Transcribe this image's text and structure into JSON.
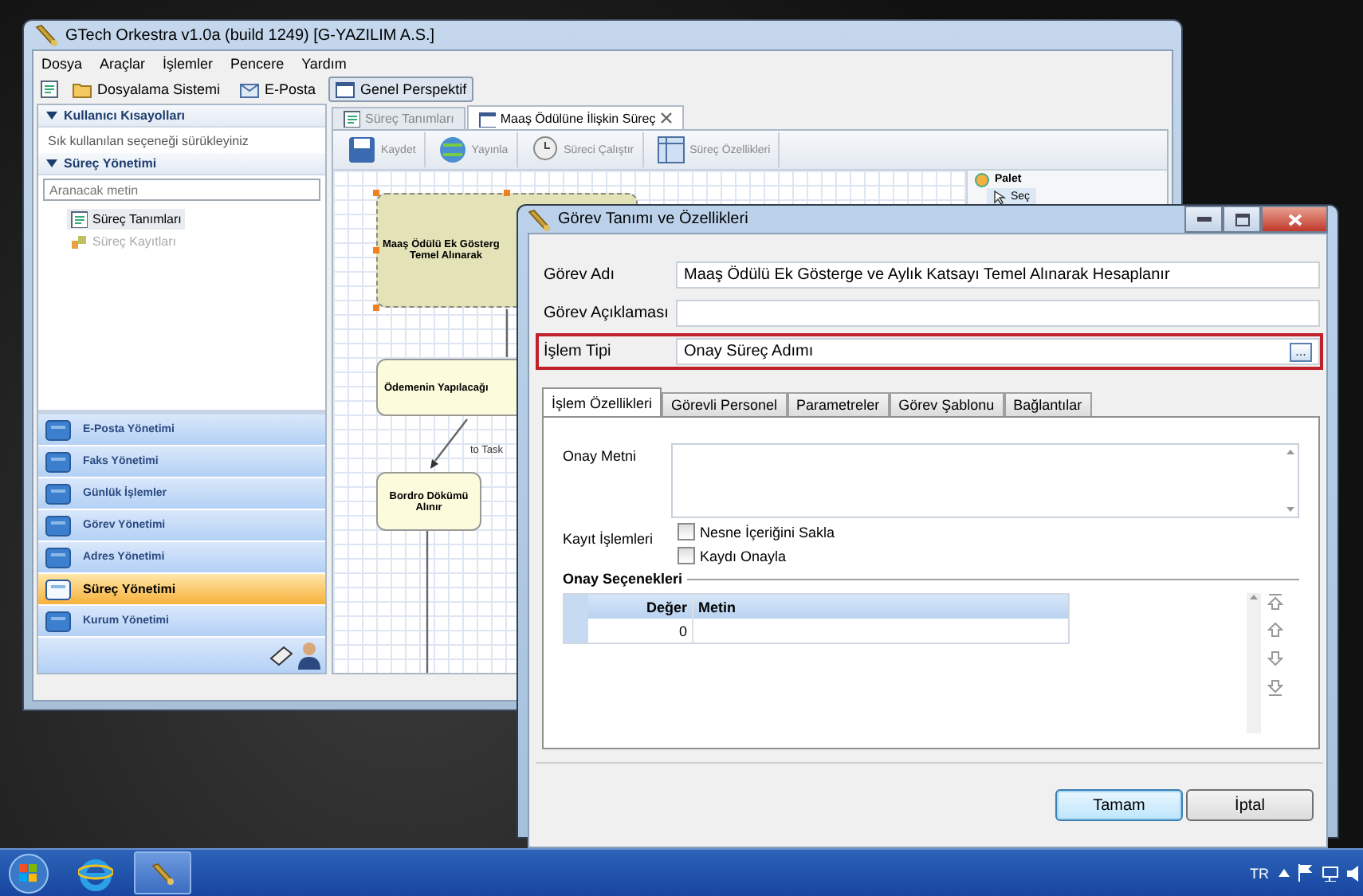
{
  "main_window": {
    "title": "GTech Orkestra v1.0a (build 1249) [G-YAZILIM A.S.]",
    "menu": [
      "Dosya",
      "Araçlar",
      "İşlemler",
      "Pencere",
      "Yardım"
    ],
    "toolbar": [
      {
        "label": "Dosyalama Sistemi",
        "selected": false
      },
      {
        "label": "E-Posta",
        "selected": false
      },
      {
        "label": "Genel Perspektif",
        "selected": true
      }
    ]
  },
  "shortcuts": {
    "title": "Kullanıcı Kısayolları",
    "hint": "Sık kullanılan seçeneği sürükleyiniz"
  },
  "process_panel": {
    "title": "Süreç Yönetimi",
    "search": {
      "placeholder": "Aranacak metin"
    },
    "tree": [
      {
        "label": "Süreç Tanımları",
        "selected": true,
        "disabled": false
      },
      {
        "label": "Süreç Kayıtları",
        "selected": false,
        "disabled": true
      }
    ]
  },
  "nav_bar": [
    {
      "label": "E-Posta Yönetimi",
      "selected": false
    },
    {
      "label": "Faks Yönetimi",
      "selected": false
    },
    {
      "label": "Günlük İşlemler",
      "selected": false
    },
    {
      "label": "Görev Yönetimi",
      "selected": false
    },
    {
      "label": "Adres Yönetimi",
      "selected": false
    },
    {
      "label": "Süreç Yönetimi",
      "selected": true
    },
    {
      "label": "Kurum Yönetimi",
      "selected": false
    }
  ],
  "editor": {
    "tabs": [
      {
        "label": "Süreç Tanımları",
        "selected": false,
        "closable": false
      },
      {
        "label": "Maaş Ödülüne İlişkin Süreç",
        "selected": true,
        "closable": true
      }
    ],
    "toolbar": [
      {
        "label": "Kaydet",
        "disabled": true
      },
      {
        "label": "Yayınla",
        "disabled": true
      },
      {
        "label": "Süreci Çalıştır",
        "disabled": true
      },
      {
        "label": "Süreç Özellikleri",
        "disabled": true
      }
    ],
    "diagram": {
      "nodes": [
        {
          "lines": [
            "Maaş Ödülü Ek Gösterg",
            "Temel Alınarak"
          ],
          "selected": true
        },
        {
          "lines": [
            "Ödemenin Yapılacağı"
          ],
          "selected": false
        },
        {
          "lines": [
            "Bordro Dökümü",
            "Alınır"
          ],
          "selected": false
        }
      ],
      "edge_label": "to Task"
    },
    "palette": {
      "title": "Palet",
      "items": [
        "Seç"
      ]
    }
  },
  "dialog": {
    "title": "Görev Tanımı ve Özellikleri",
    "fields": [
      {
        "label": "Görev Adı",
        "value": "Maaş Ödülü Ek Gösterge ve Aylık Katsayı Temel Alınarak Hesaplanır",
        "highlighted": false,
        "browse": false
      },
      {
        "label": "Görev Açıklaması",
        "highlighted": false,
        "browse": false
      },
      {
        "label": "İşlem Tipi",
        "value": "Onay Süreç Adımı",
        "highlighted": true,
        "browse": true
      }
    ],
    "browse_button": "...",
    "tabs": [
      {
        "label": "İşlem Özellikleri",
        "selected": true
      },
      {
        "label": "Görevli Personel",
        "selected": false
      },
      {
        "label": "Parametreler",
        "selected": false
      },
      {
        "label": "Görev Şablonu",
        "selected": false
      },
      {
        "label": "Bağlantılar",
        "selected": false
      }
    ],
    "approval_text": {
      "label": "Onay Metni"
    },
    "record_ops": {
      "label": "Kayıt İşlemleri",
      "options": [
        {
          "label": "Nesne İçeriğini Sakla",
          "checked": false
        },
        {
          "label": "Kaydı Onayla",
          "checked": false
        }
      ]
    },
    "options_section": {
      "title": "Onay Seçenekleri",
      "columns": [
        "Değer",
        "Metin"
      ],
      "rows": [
        {
          "value": "0"
        }
      ]
    },
    "buttons": [
      {
        "label": "Tamam",
        "default": true
      },
      {
        "label": "İptal",
        "default": false
      }
    ]
  },
  "taskbar": {
    "language": "TR"
  }
}
